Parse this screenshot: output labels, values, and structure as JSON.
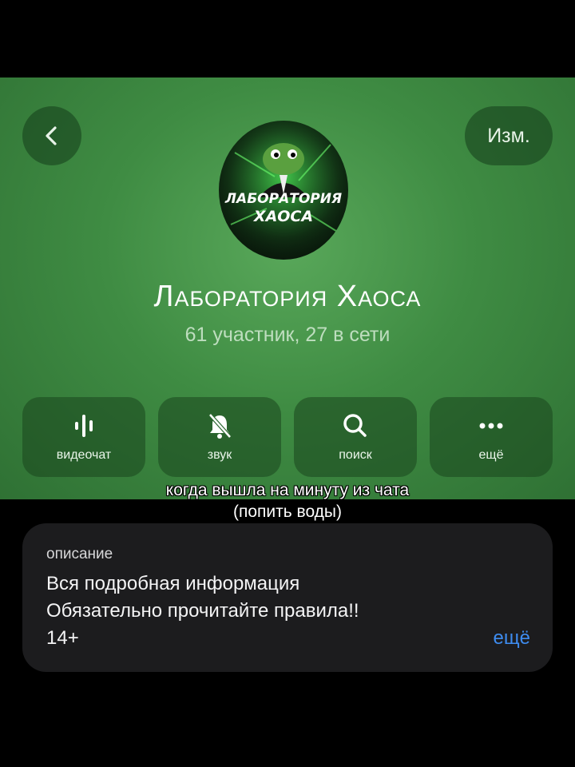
{
  "header": {
    "edit_label": "Изм.",
    "avatar_text_line1": "ЛАБОРАТОРИЯ",
    "avatar_text_line2": "ХАОСА",
    "title": "Лаборатория Хаоса",
    "subtitle": "61 участник, 27 в сети"
  },
  "actions": [
    {
      "label": "видеочат",
      "icon": "voice-chat-icon"
    },
    {
      "label": "звук",
      "icon": "bell-muted-icon"
    },
    {
      "label": "поиск",
      "icon": "search-icon"
    },
    {
      "label": "ещё",
      "icon": "more-dots-icon"
    }
  ],
  "caption": {
    "line1": "когда вышла на минуту из чата",
    "line2": "(попить воды)"
  },
  "description": {
    "label": "описание",
    "line1": "Вся подробная информация",
    "line2": "Обязательно прочитайте правила!!",
    "line3": "14+",
    "more_label": "ещё"
  },
  "colors": {
    "header_green": "#3f8c43",
    "card_bg": "#1c1c1e",
    "link_blue": "#3e8cf0"
  }
}
